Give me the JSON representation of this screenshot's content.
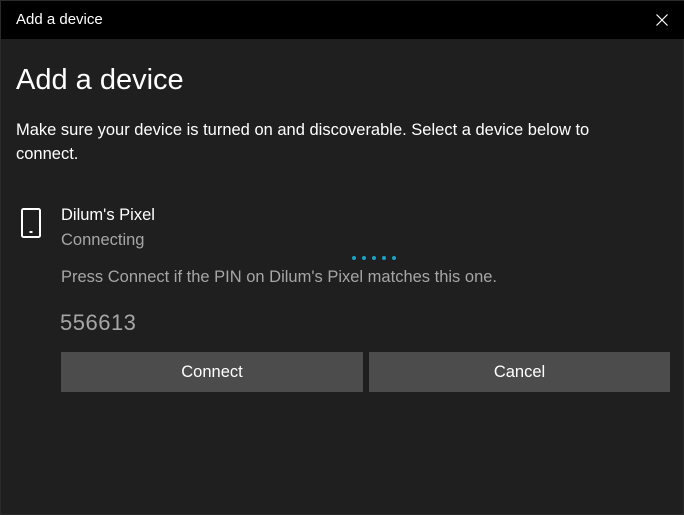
{
  "window": {
    "title": "Add a device"
  },
  "header": {
    "heading": "Add a device",
    "description": "Make sure your device is turned on and discoverable. Select a device below to connect."
  },
  "device": {
    "icon": "smartphone-icon",
    "name": "Dilum's Pixel",
    "status": "Connecting",
    "pin_hint": "Press Connect if the PIN on Dilum's Pixel matches this one.",
    "pin": "556613"
  },
  "actions": {
    "connect_label": "Connect",
    "cancel_label": "Cancel"
  },
  "colors": {
    "accent": "#1ba1c4",
    "background": "#1f1f1f",
    "titlebar": "#000000",
    "button": "#4c4c4c",
    "secondary_text": "#a6a6a6"
  }
}
